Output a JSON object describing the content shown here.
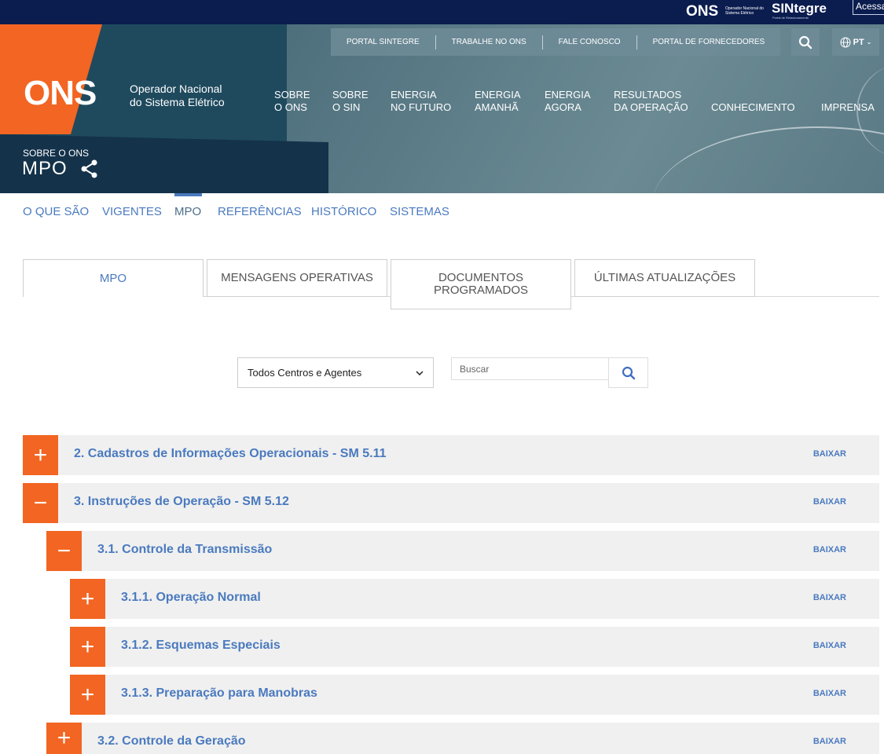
{
  "topbar": {
    "ons_logo": "ONS",
    "ons_sub": "Operador Nacional do Sistema Elétrico",
    "sintegre": "SINtegre",
    "sintegre_sub": "Portal de Relacionamento",
    "acessar": "Acessar"
  },
  "hero": {
    "logo_mark": "ONS",
    "logo_line1": "Operador Nacional",
    "logo_line2": "do Sistema Elétrico",
    "util_links": [
      "PORTAL SINTEGRE",
      "TRABALHE NO ONS",
      "FALE CONOSCO",
      "PORTAL DE FORNECEDORES"
    ],
    "language": "PT",
    "nav": [
      {
        "l1": "SOBRE",
        "l2": "O ONS"
      },
      {
        "l1": "SOBRE",
        "l2": "O SIN"
      },
      {
        "l1": "ENERGIA",
        "l2": "NO FUTURO"
      },
      {
        "l1": "ENERGIA",
        "l2": "AMANHÃ"
      },
      {
        "l1": "ENERGIA",
        "l2": "AGORA"
      },
      {
        "l1": "RESULTADOS",
        "l2": "DA OPERAÇÃO"
      },
      {
        "l1": "",
        "l2": "CONHECIMENTO"
      },
      {
        "l1": "",
        "l2": "IMPRENSA"
      }
    ],
    "breadcrumb": "SOBRE O ONS",
    "page_title": "MPO"
  },
  "subnav": [
    "O QUE SÃO",
    "VIGENTES",
    "MPO",
    "REFERÊNCIAS",
    "HISTÓRICO",
    "SISTEMAS"
  ],
  "tabs": [
    "MPO",
    "MENSAGENS OPERATIVAS",
    "DOCUMENTOS PROGRAMADOS",
    "ÚLTIMAS ATUALIZAÇÕES"
  ],
  "filter": {
    "select_value": "Todos Centros e Agentes",
    "search_placeholder": "Buscar"
  },
  "tree": [
    {
      "title": "2. Cadastros de Informações Operacionais - SM 5.11",
      "expanded": false,
      "level": 0,
      "action": "BAIXAR"
    },
    {
      "title": "3. Instruções de Operação - SM 5.12",
      "expanded": true,
      "level": 0,
      "action": "BAIXAR"
    },
    {
      "title": "3.1. Controle da Transmissão",
      "expanded": true,
      "level": 1,
      "action": "BAIXAR"
    },
    {
      "title": "3.1.1. Operação Normal",
      "expanded": false,
      "level": 2,
      "action": "BAIXAR"
    },
    {
      "title": "3.1.2. Esquemas Especiais",
      "expanded": false,
      "level": 2,
      "action": "BAIXAR"
    },
    {
      "title": "3.1.3. Preparação para Manobras",
      "expanded": false,
      "level": 2,
      "action": "BAIXAR"
    },
    {
      "title": "3.2. Controle da Geração",
      "expanded": false,
      "level": 1,
      "action": "BAIXAR"
    }
  ],
  "colors": {
    "brand_orange": "#f26522",
    "link_blue": "#4a7abf",
    "top_navy": "#0b1c4f"
  }
}
